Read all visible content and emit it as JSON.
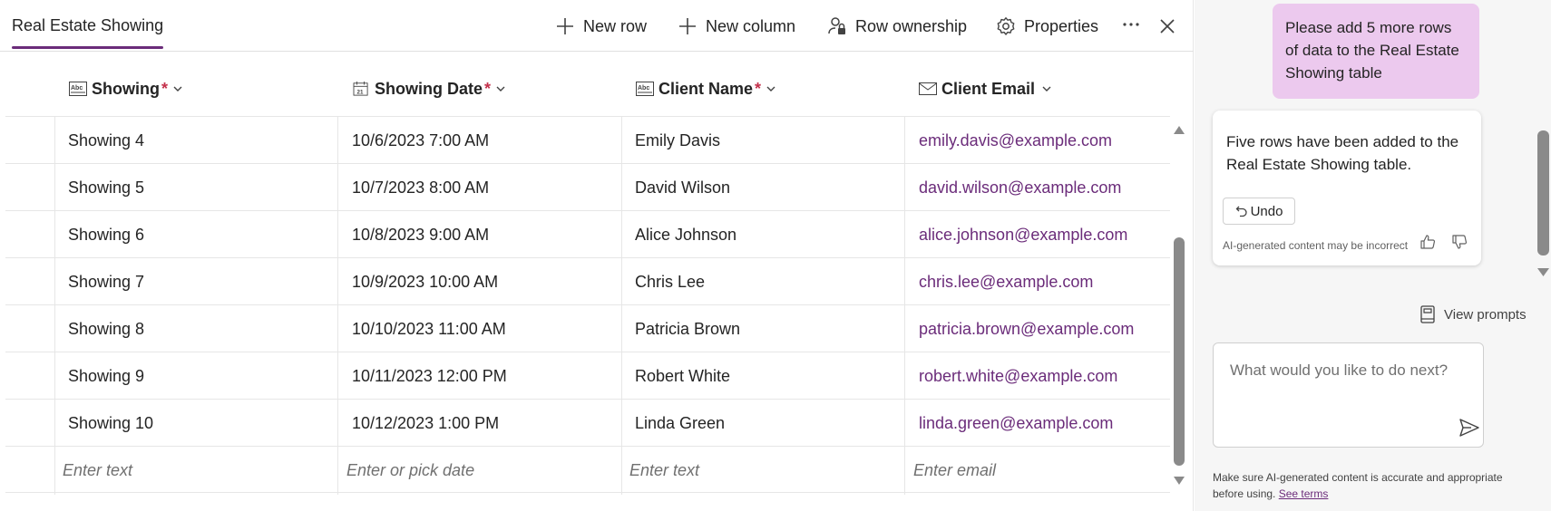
{
  "toolbar": {
    "tab_title": "Real Estate Showing",
    "new_row": "New row",
    "new_column": "New column",
    "row_ownership": "Row ownership",
    "properties": "Properties"
  },
  "icons": {
    "new_row": "plus-icon",
    "new_column": "plus-icon",
    "row_ownership": "person-lock-icon",
    "properties": "gear-icon",
    "more": "ellipsis-icon",
    "close": "close-icon",
    "text_column": "text-type-icon",
    "date_column": "calendar-icon",
    "email_column": "mail-icon",
    "undo": "undo-icon",
    "thumbs_up": "thumbs-up-icon",
    "thumbs_down": "thumbs-down-icon",
    "view_prompts": "book-icon",
    "send": "send-icon"
  },
  "table": {
    "columns": [
      {
        "label": "Showing",
        "required": "*"
      },
      {
        "label": "Showing Date",
        "required": "*"
      },
      {
        "label": "Client Name",
        "required": "*"
      },
      {
        "label": "Client Email",
        "required": ""
      }
    ],
    "rows": [
      [
        "Showing 4",
        "10/6/2023 7:00 AM",
        "Emily Davis",
        "emily.davis@example.com"
      ],
      [
        "Showing 5",
        "10/7/2023 8:00 AM",
        "David Wilson",
        "david.wilson@example.com"
      ],
      [
        "Showing 6",
        "10/8/2023 9:00 AM",
        "Alice Johnson",
        "alice.johnson@example.com"
      ],
      [
        "Showing 7",
        "10/9/2023 10:00 AM",
        "Chris Lee",
        "chris.lee@example.com"
      ],
      [
        "Showing 8",
        "10/10/2023 11:00 AM",
        "Patricia Brown",
        "patricia.brown@example.com"
      ],
      [
        "Showing 9",
        "10/11/2023 12:00 PM",
        "Robert White",
        "robert.white@example.com"
      ],
      [
        "Showing 10",
        "10/12/2023 1:00 PM",
        "Linda Green",
        "linda.green@example.com"
      ]
    ],
    "new_row_placeholders": [
      "Enter text",
      "Enter or pick date",
      "Enter text",
      "Enter email"
    ]
  },
  "chat": {
    "user_message": "Please add 5 more rows of data to the Real Estate Showing  table",
    "ai_message": "Five rows have been added to the Real Estate Showing  table.",
    "undo_label": "Undo",
    "ai_disclaimer": "AI-generated content may be incorrect",
    "view_prompts": "View prompts",
    "input_placeholder": "What would you like to do next?",
    "footer_text": "Make sure AI-generated content is accurate and appropriate before using.",
    "see_terms": "See terms"
  },
  "colors": {
    "accent": "#6b2c7a",
    "user_bubble": "#ecc9ee",
    "required": "#c4314b"
  }
}
